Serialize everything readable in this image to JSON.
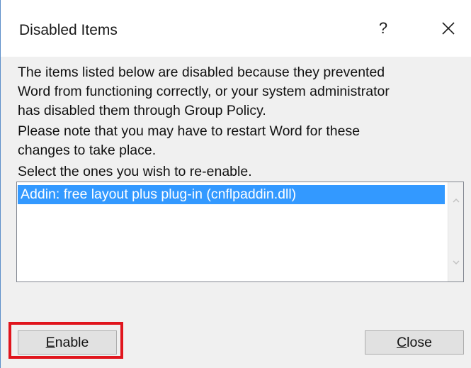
{
  "dialog": {
    "title": "Disabled Items",
    "help_label": "?",
    "close_icon": "close-icon"
  },
  "content": {
    "paragraph1": "The items listed below are disabled because they prevented\nWord from functioning correctly, or your system administrator\nhas disabled them through Group Policy.",
    "paragraph2": "Please note that you may have to restart Word for these\nchanges to take place.",
    "paragraph3": "Select the ones you wish to re-enable."
  },
  "list": {
    "items": [
      {
        "label": "Addin: free layout plus plug-in (cnflpaddin.dll)",
        "selected": true
      }
    ],
    "scroll_up_icon": "chevron-up-icon",
    "scroll_down_icon": "chevron-down-icon"
  },
  "buttons": {
    "enable_label": "Enable",
    "enable_mnemonic": "E",
    "enable_rest": "nable",
    "close_label": "Close",
    "close_mnemonic": "C",
    "close_rest": "lose"
  },
  "annotation": {
    "highlight_color": "#e0151d",
    "highlight_target": "enable-button"
  },
  "colors": {
    "selection": "#3399ff",
    "dialog_bg": "#f0f0f0",
    "button_bg": "#e1e1e1"
  }
}
